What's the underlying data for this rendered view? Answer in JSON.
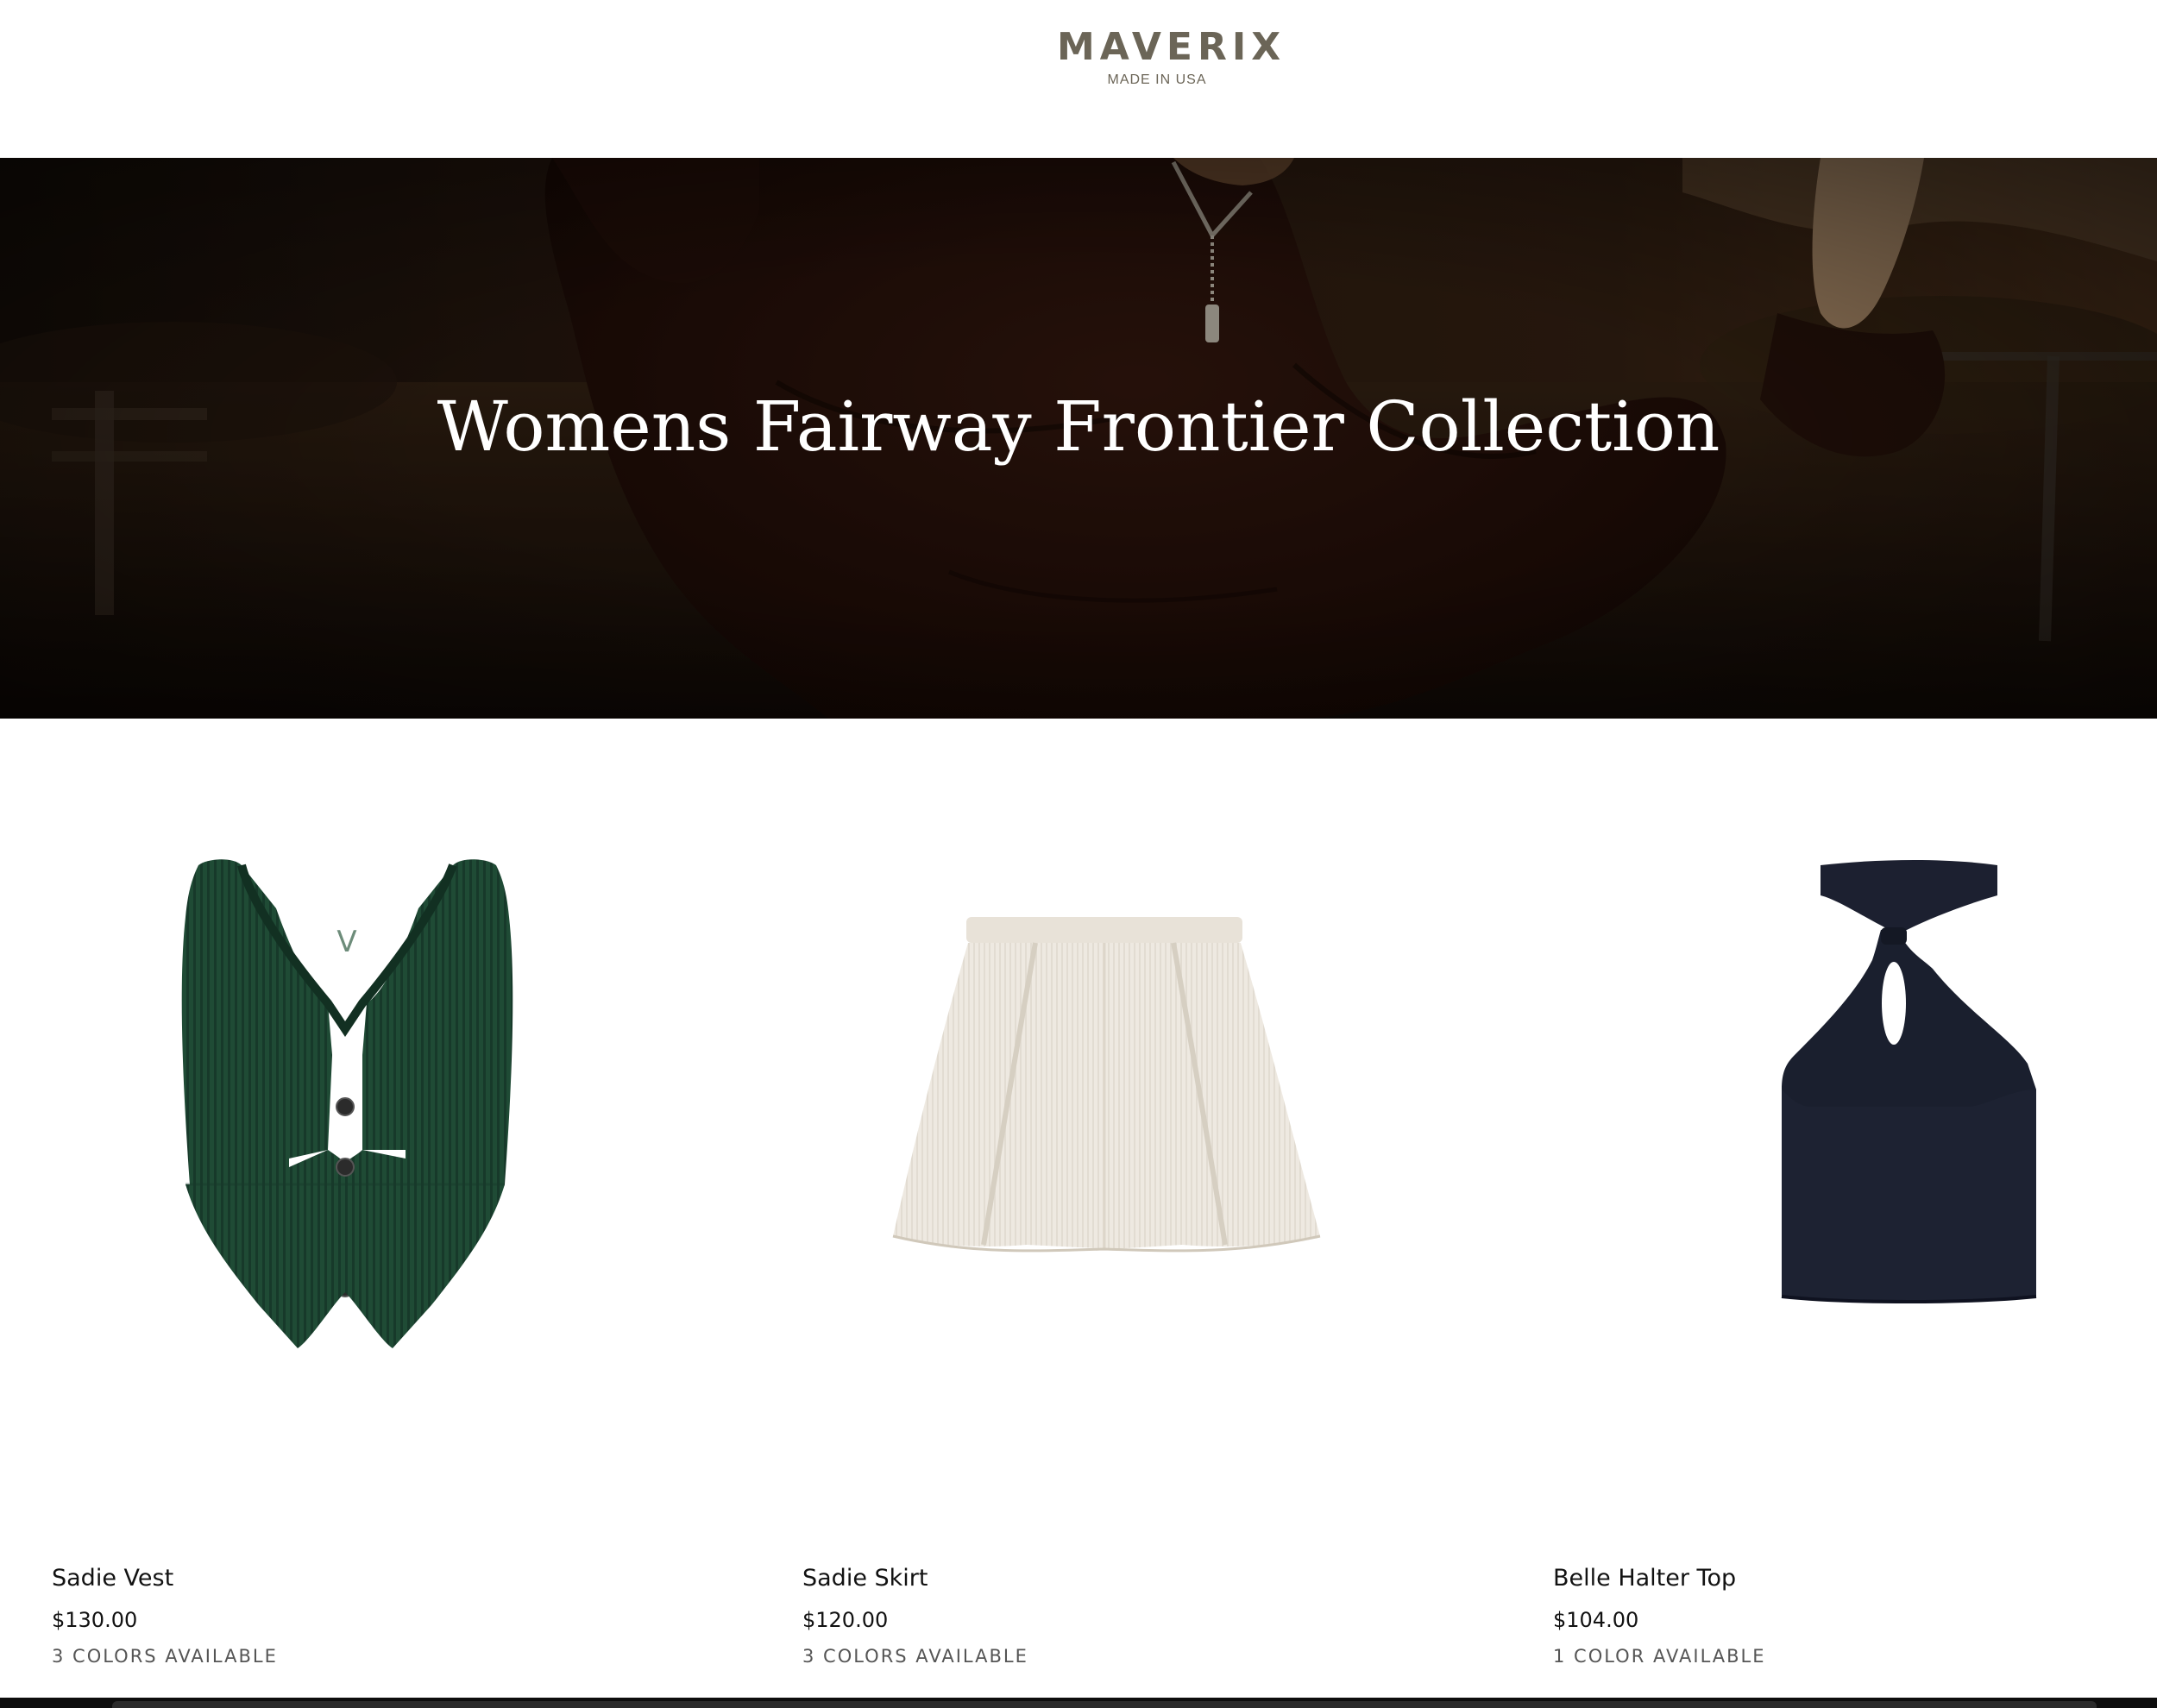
{
  "brand": {
    "name": "MAVERIX",
    "tagline": "MADE IN USA",
    "color": "#6b6557"
  },
  "hero": {
    "title": "Womens Fairway Frontier Collection"
  },
  "products": [
    {
      "name": "Sadie Vest",
      "price": "$130.00",
      "colors": "3 COLORS AVAILABLE",
      "swatch": "#1d4a34"
    },
    {
      "name": "Sadie Skirt",
      "price": "$120.00",
      "colors": "3 COLORS AVAILABLE",
      "swatch": "#ece6dd"
    },
    {
      "name": "Belle Halter Top",
      "price": "$104.00",
      "colors": "1 COLOR AVAILABLE",
      "swatch": "#1a1f2e"
    }
  ]
}
